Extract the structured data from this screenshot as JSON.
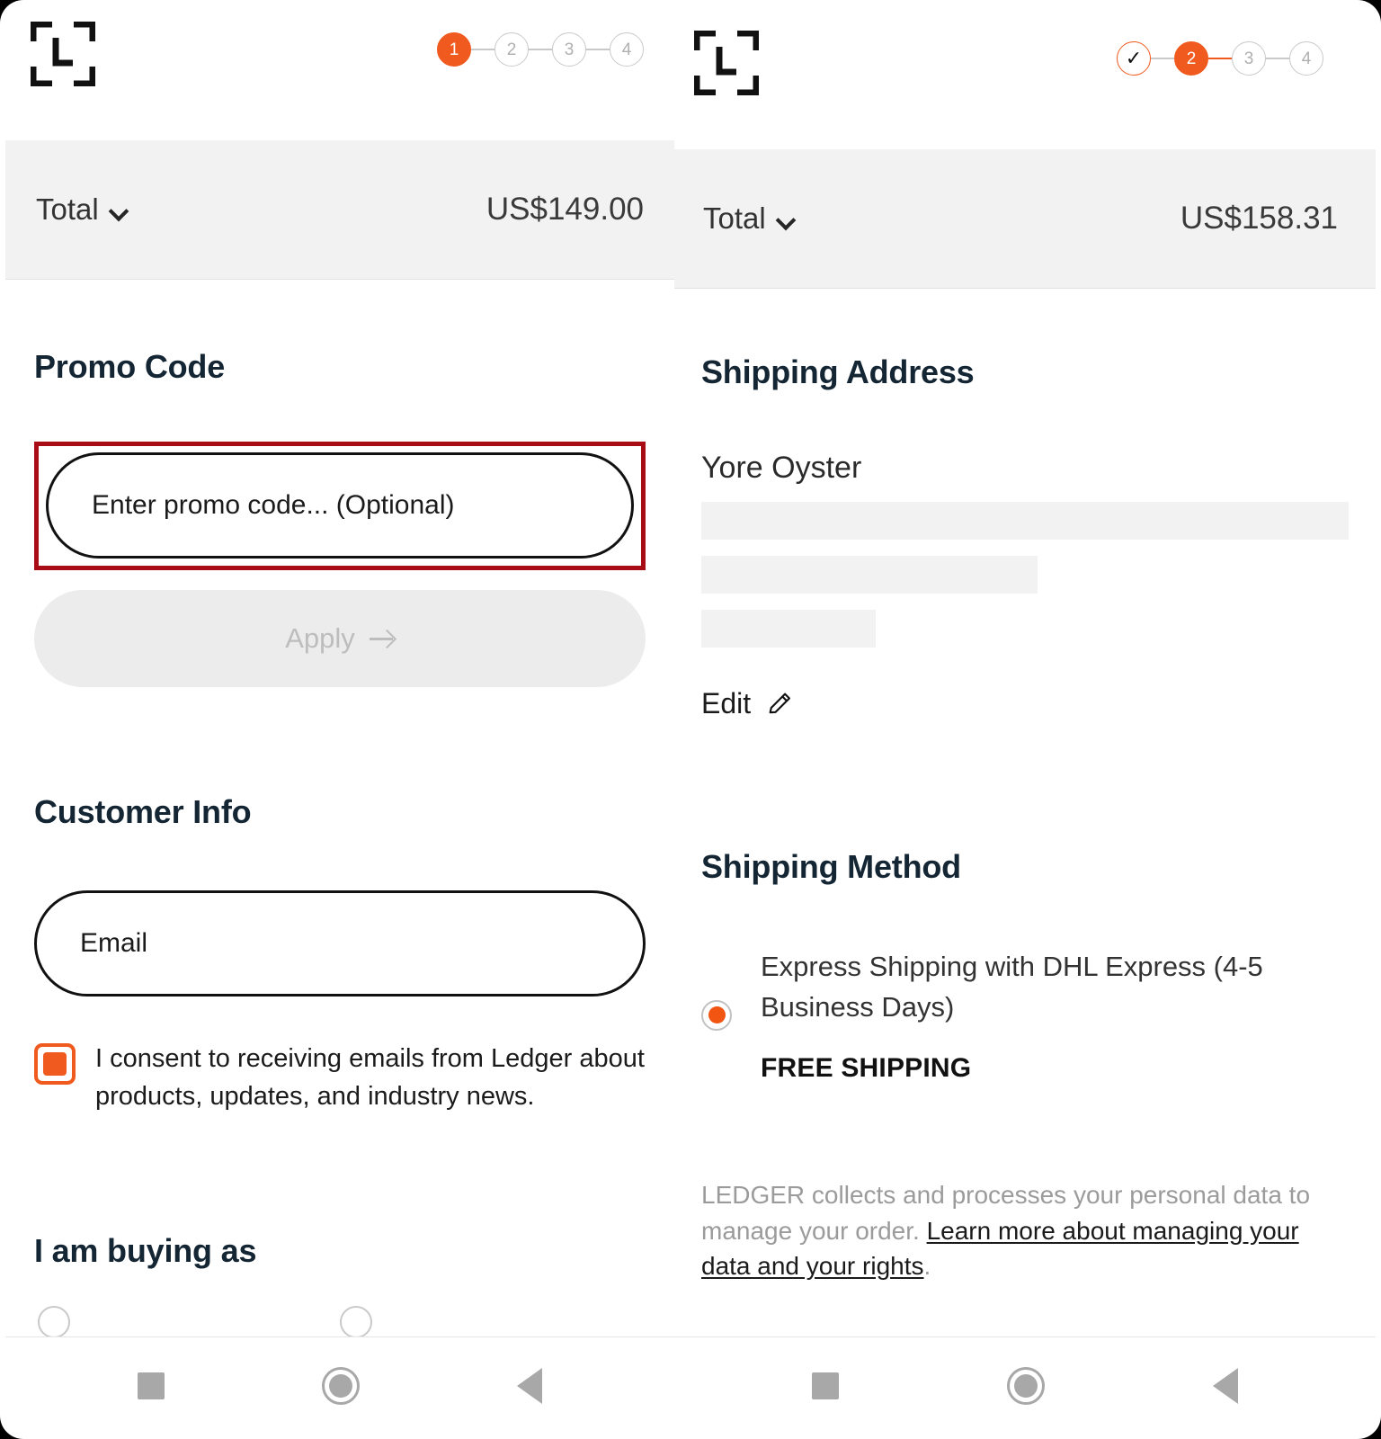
{
  "brand": {
    "accent_color": "#f05a1e",
    "logo_icon": "ledger-logo-icon",
    "name": "LEDGER"
  },
  "annotation": {
    "highlight_color": "#a80c14",
    "target": "promo-code-input"
  },
  "left_panel": {
    "stepper": {
      "steps": [
        {
          "label": "1",
          "state": "active"
        },
        {
          "label": "2",
          "state": "todo"
        },
        {
          "label": "3",
          "state": "todo"
        },
        {
          "label": "4",
          "state": "todo"
        }
      ]
    },
    "total": {
      "label": "Total",
      "chevron_icon": "chevron-down-icon",
      "value": "US$149.00"
    },
    "promo": {
      "title": "Promo Code",
      "input_placeholder": "Enter promo code... (Optional)",
      "input_value": "",
      "apply_label": "Apply",
      "apply_arrow_icon": "arrow-right-icon",
      "apply_disabled": true
    },
    "customer": {
      "title": "Customer Info",
      "email_placeholder": "Email",
      "email_value": "",
      "consent_checked": true,
      "consent_text": "I consent to receiving emails from Ledger about products, updates, and industry news."
    },
    "buying_as": {
      "title": "I am buying as"
    }
  },
  "right_panel": {
    "stepper": {
      "steps": [
        {
          "label": "✓",
          "state": "done"
        },
        {
          "label": "2",
          "state": "active"
        },
        {
          "label": "3",
          "state": "todo"
        },
        {
          "label": "4",
          "state": "todo"
        }
      ]
    },
    "total": {
      "label": "Total",
      "chevron_icon": "chevron-down-icon",
      "value": "US$158.31"
    },
    "shipping_address": {
      "title": "Shipping Address",
      "recipient": "Yore Oyster",
      "redacted_lines": 3,
      "edit_label": "Edit",
      "edit_icon": "pencil-icon"
    },
    "shipping_method": {
      "title": "Shipping Method",
      "option_selected": true,
      "option_name": "Express Shipping with DHL Express (4-5 Business Days)",
      "option_price": "FREE SHIPPING"
    },
    "legal": {
      "text_before": "LEDGER collects and processes your personal data to manage your order. ",
      "link_text": "Learn more about managing your data and your rights",
      "text_after": "."
    }
  },
  "navbar": {
    "recents_icon": "square-recents-icon",
    "home_icon": "circle-home-icon",
    "back_icon": "triangle-back-icon"
  }
}
